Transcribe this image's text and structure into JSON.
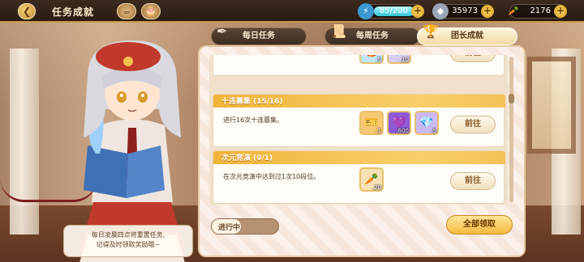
{
  "topbar": {
    "back_icon": "back-arrow-icon",
    "title": "任务成就",
    "stamina": "85/200",
    "gems": "35973",
    "carrots": "2176"
  },
  "tabs": [
    {
      "label": "每日任务",
      "active": false
    },
    {
      "label": "每周任务",
      "active": false
    },
    {
      "label": "团长成就",
      "active": true
    }
  ],
  "tasks": [
    {
      "title": "",
      "desc": "",
      "rewards": [
        {
          "icon": "gift-icon",
          "count": "5"
        },
        {
          "icon": "crystal-icon",
          "count": "10"
        }
      ],
      "button": "前往"
    },
    {
      "title": "十连募集 (15/16)",
      "desc": "进行16次十连募集。",
      "rewards": [
        {
          "icon": "ticket-icon",
          "count": "1"
        },
        {
          "icon": "purple-gem-icon",
          "count": "600"
        },
        {
          "icon": "crystal-icon",
          "count": "5"
        }
      ],
      "button": "前往"
    },
    {
      "title": "次元竞演 (0/1)",
      "desc": "在次元竞演中达到过1次10段位。",
      "rewards": [
        {
          "icon": "carrot-icon",
          "count": "20"
        }
      ],
      "button": "前往"
    }
  ],
  "bottom": {
    "progress_label": "进行中",
    "claim_all": "全部领取"
  },
  "hint": {
    "line1": "每日凌晨四点将重置任务,",
    "line2": "记得及时领取奖励哦~"
  },
  "colors": {
    "accent": "#f4b93e",
    "panel": "#fbf1ea",
    "header": "#2a1c12"
  }
}
